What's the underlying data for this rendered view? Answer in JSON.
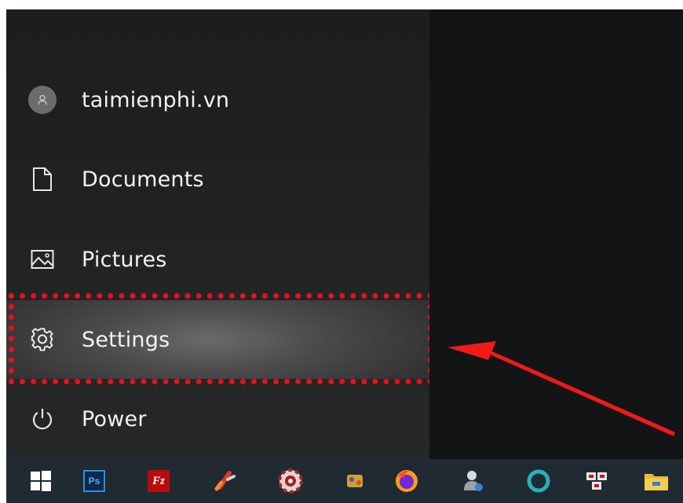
{
  "start_menu": {
    "user": {
      "name": "taimienphi.vn",
      "icon": "user-avatar-icon"
    },
    "items": [
      {
        "label": "Documents",
        "icon": "document-icon"
      },
      {
        "label": "Pictures",
        "icon": "pictures-icon"
      },
      {
        "label": "Settings",
        "icon": "gear-icon",
        "highlighted": true
      },
      {
        "label": "Power",
        "icon": "power-icon"
      }
    ]
  },
  "annotation": {
    "highlight_color": "#e8101a",
    "arrow_color": "#f01a1a"
  },
  "taskbar": {
    "background": "#1f2a33",
    "apps": [
      {
        "icon": "windows-start-icon"
      },
      {
        "icon": "photoshop-icon",
        "text": "Ps"
      },
      {
        "icon": "filezilla-icon",
        "text": "Fz"
      },
      {
        "icon": "ccleaner-icon"
      },
      {
        "icon": "casino-chip-icon"
      },
      {
        "icon": "game-app-icon"
      },
      {
        "icon": "firefox-icon"
      },
      {
        "icon": "user-admin-icon"
      },
      {
        "icon": "sync-icon"
      },
      {
        "icon": "unikey-icon"
      },
      {
        "icon": "file-explorer-icon"
      }
    ]
  }
}
